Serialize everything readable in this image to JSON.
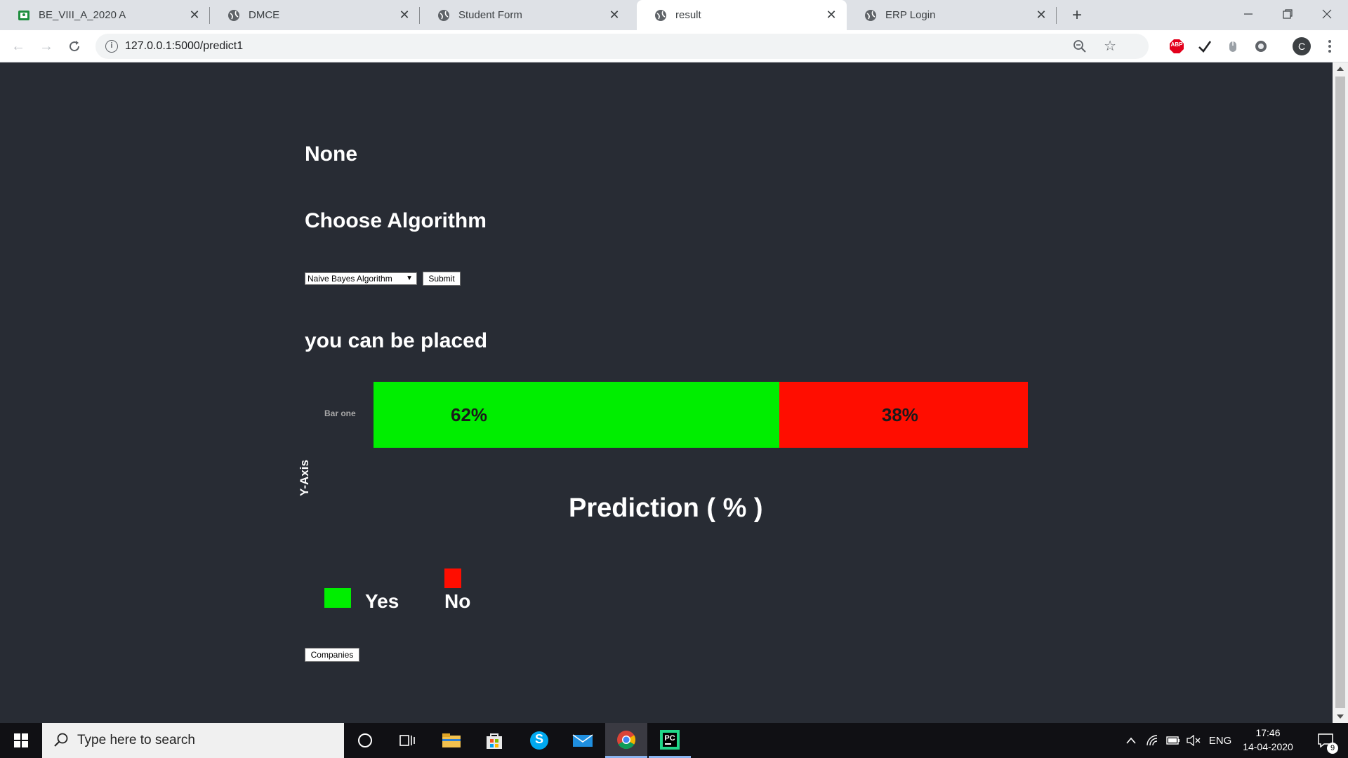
{
  "browser": {
    "tabs": [
      {
        "title": "BE_VIII_A_2020 A",
        "active": false
      },
      {
        "title": "DMCE",
        "active": false
      },
      {
        "title": "Student Form",
        "active": false
      },
      {
        "title": "result",
        "active": true
      },
      {
        "title": "ERP Login",
        "active": false
      }
    ],
    "new_tab": "+",
    "url": "127.0.0.1:5000/predict1",
    "profile_initial": "C",
    "abp_label": "ABP"
  },
  "page": {
    "heading_none": "None",
    "heading_choose": "Choose Algorithm",
    "algorithm_select": {
      "selected": "Naive Bayes Algorithm"
    },
    "submit_label": "Submit",
    "result_text": "you can be placed",
    "companies_label": "Companies"
  },
  "chart_data": {
    "type": "bar",
    "orientation": "horizontal-stacked",
    "categories": [
      "Bar one"
    ],
    "series": [
      {
        "name": "Yes",
        "values": [
          62
        ],
        "color": "#00ee00",
        "label": "62%"
      },
      {
        "name": "No",
        "values": [
          38
        ],
        "color": "#ff0d00",
        "label": "38%"
      }
    ],
    "xlabel": "Prediction ( % )",
    "ylabel": "Y-Axis",
    "xlim": [
      0,
      100
    ]
  },
  "taskbar": {
    "search_placeholder": "Type here to search",
    "language": "ENG",
    "time": "17:46",
    "date": "14-04-2020",
    "notification_count": "9",
    "pycharm_label": "PC",
    "skype_label": "S"
  }
}
